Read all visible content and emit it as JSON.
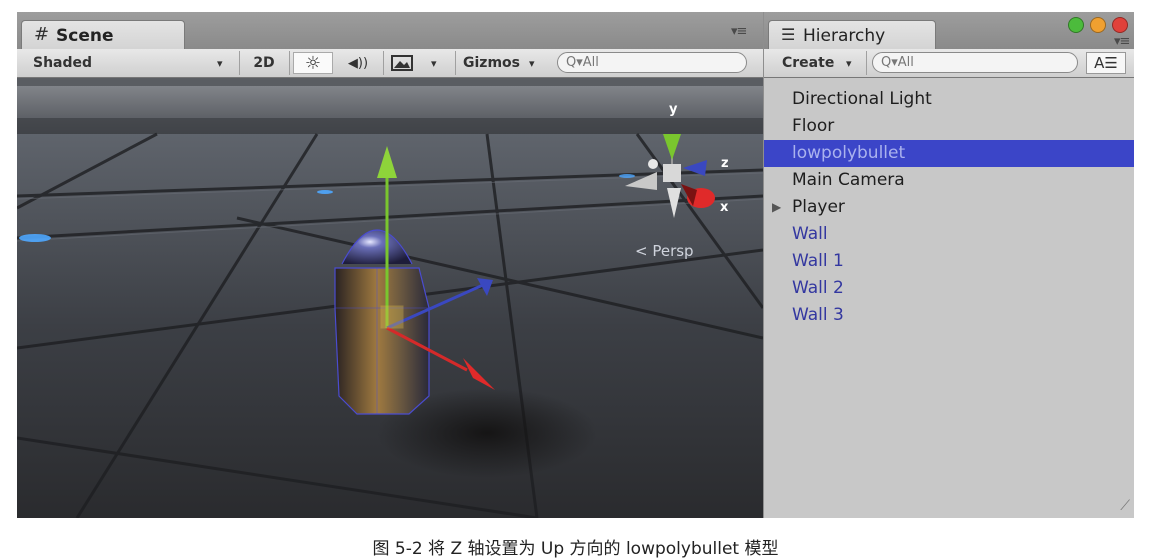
{
  "scene": {
    "tab_icon": "#",
    "tab_label": "Scene",
    "panel_menu_icon": "▾≡",
    "toolbar": {
      "shading_mode": "Shaded",
      "shading_arrow": "▾",
      "mode_2d": "2D",
      "lighting_icon": "☼",
      "audio_icon": "◀))",
      "effects_icon": "image-icon",
      "effects_arrow": "▾",
      "gizmos_label": "Gizmos",
      "gizmos_arrow": "▾",
      "search_placeholder": "Q▾All"
    },
    "view_label": "< Persp",
    "gizmo_axes": {
      "y": "y",
      "z": "z",
      "x": "x"
    }
  },
  "hierarchy": {
    "tab_icon": "☰",
    "tab_label": "Hierarchy",
    "panel_menu_icon": "▾≡",
    "create_label": "Create",
    "create_arrow": "▾",
    "search_placeholder": "Q▾All",
    "sort_icon": "A☰",
    "items": [
      {
        "label": "Directional Light",
        "state": "normal"
      },
      {
        "label": "Floor",
        "state": "normal"
      },
      {
        "label": "lowpolybullet",
        "state": "selected"
      },
      {
        "label": "Main Camera",
        "state": "normal"
      },
      {
        "label": "Player",
        "state": "normal",
        "expand_icon": "▶"
      },
      {
        "label": "Wall",
        "state": "prefab"
      },
      {
        "label": "Wall 1",
        "state": "prefab"
      },
      {
        "label": "Wall 2",
        "state": "prefab"
      },
      {
        "label": "Wall 3",
        "state": "prefab"
      }
    ],
    "resize_grip": "⟋"
  },
  "window_controls": {
    "minimize_color": "#4cbb3c",
    "zoom_color": "#f0a030",
    "close_color": "#e0413a"
  },
  "colors": {
    "selection": "#3b45c8",
    "prefab_text": "#3337a0",
    "axis_x": "#d42a2a",
    "axis_y": "#7ac62e",
    "axis_z": "#3a48c0"
  },
  "caption": "图 5-2 将 Z 轴设置为 Up 方向的 lowpolybullet 模型"
}
